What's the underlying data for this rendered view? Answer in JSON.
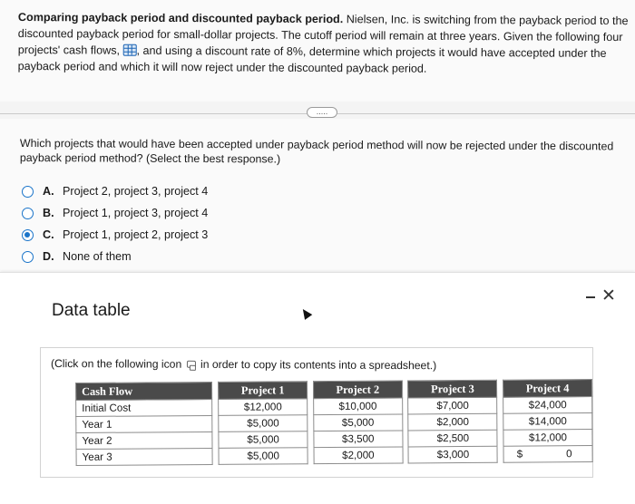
{
  "problem": {
    "title": "Comparing payback period and discounted payback period.",
    "text_before_icon": " Nielsen, Inc. is switching from the payback period to the discounted payback period for small-dollar projects. The cutoff period will remain at three years. Given the following four projects' cash flows, ",
    "text_after_icon": ", and using a discount rate of 8%, determine which projects it would have accepted under the payback period and which it will now reject under the discounted payback period.",
    "more_label": "....."
  },
  "question": {
    "text": "Which projects that would have been accepted under payback period method will now be rejected under the discounted payback period method? (Select the best response.)",
    "options": [
      {
        "letter": "A.",
        "label": "Project 2, project 3, project 4",
        "selected": false
      },
      {
        "letter": "B.",
        "label": "Project 1, project 3, project 4",
        "selected": false
      },
      {
        "letter": "C.",
        "label": "Project 1, project 2, project 3",
        "selected": true
      },
      {
        "letter": "D.",
        "label": "None of them",
        "selected": false
      }
    ]
  },
  "data_table": {
    "title": "Data table",
    "minimize_glyph": "–",
    "close_glyph": "✕",
    "hint_before": "(Click on the following icon ",
    "hint_after": " in order to copy its contents into a spreadsheet.)",
    "headers": [
      "Cash Flow",
      "Project 1",
      "Project 2",
      "Project 3",
      "Project 4"
    ],
    "rows": [
      {
        "label": "Initial Cost",
        "values": [
          "$12,000",
          "$10,000",
          "$7,000",
          "$24,000"
        ]
      },
      {
        "label": "Year 1",
        "values": [
          "$5,000",
          "$5,000",
          "$2,000",
          "$14,000"
        ]
      },
      {
        "label": "Year 2",
        "values": [
          "$5,000",
          "$3,500",
          "$2,500",
          "$12,000"
        ]
      },
      {
        "label": "Year 3",
        "values": [
          "$5,000",
          "$2,000",
          "$3,000",
          ""
        ]
      }
    ],
    "last_cell": {
      "symbol": "$",
      "value": "0"
    }
  },
  "colors": {
    "accent": "#1a74c9",
    "header_bg": "#4a4a4a"
  }
}
